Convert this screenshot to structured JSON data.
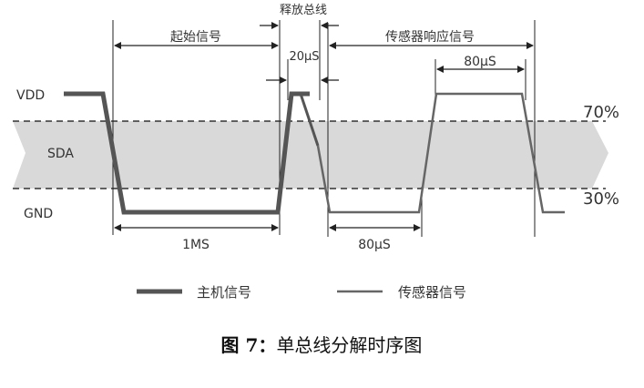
{
  "labels": {
    "vdd": "VDD",
    "sda": "SDA",
    "gnd": "GND",
    "pct_high": "70%",
    "pct_low": "30%",
    "start_signal": "起始信号",
    "release_bus": "释放总线",
    "sensor_response": "传感器响应信号",
    "t_20us": "20μS",
    "t_80us_high": "80μS",
    "t_1ms": "1MS",
    "t_80us_low": "80μS"
  },
  "legend": {
    "host": "主机信号",
    "sensor": "传感器信号"
  },
  "caption": {
    "prefix": "图 7：",
    "text": "单总线分解时序图"
  },
  "colors": {
    "band": "#d9d9d9",
    "host_line": "#555555",
    "sensor_line": "#666666",
    "line": "#222222"
  }
}
